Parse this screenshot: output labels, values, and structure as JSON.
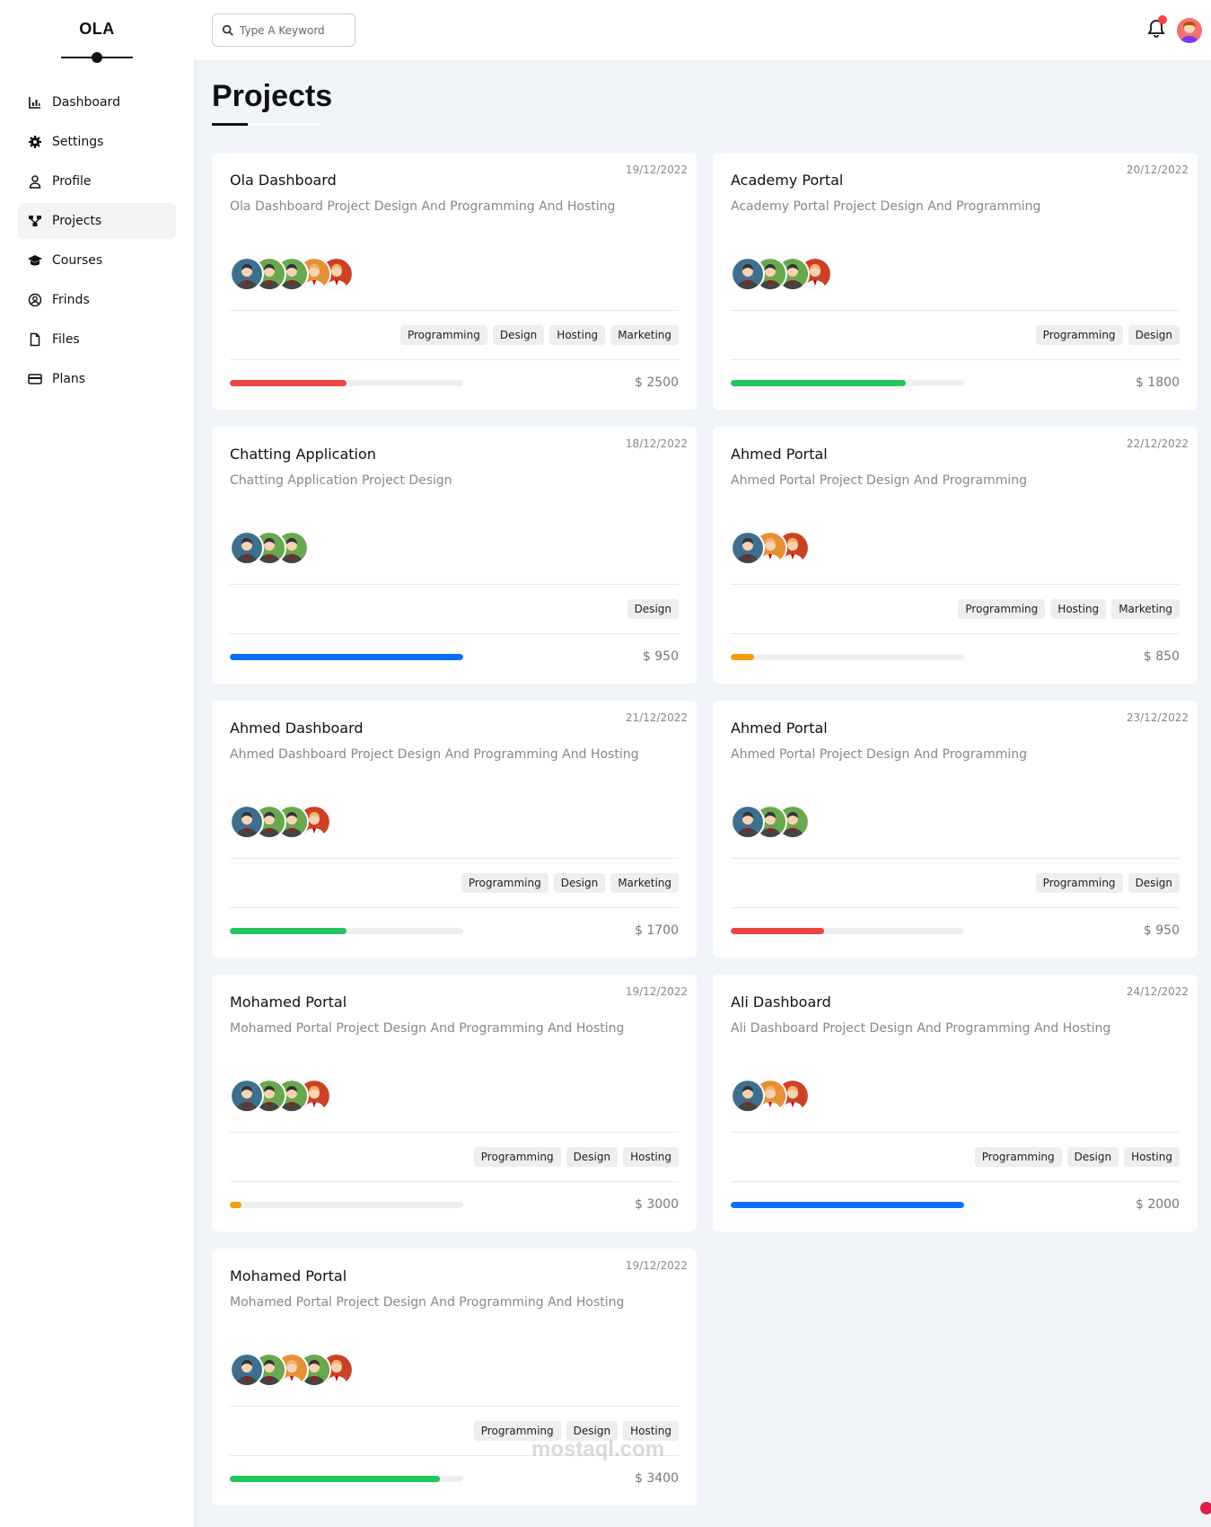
{
  "logo": "OLA",
  "sidebar": {
    "items": [
      {
        "label": "Dashboard",
        "icon": "chart-icon"
      },
      {
        "label": "Settings",
        "icon": "gear-icon"
      },
      {
        "label": "Profile",
        "icon": "user-icon"
      },
      {
        "label": "Projects",
        "icon": "diagram-icon",
        "active": true
      },
      {
        "label": "Courses",
        "icon": "graduation-cap-icon"
      },
      {
        "label": "Frinds",
        "icon": "user-circle-icon"
      },
      {
        "label": "Files",
        "icon": "file-icon"
      },
      {
        "label": "Plans",
        "icon": "credit-card-icon"
      }
    ]
  },
  "header": {
    "search_placeholder": "Type A Keyword"
  },
  "page_title": "Projects",
  "colors": {
    "red": "#ef4444",
    "green": "#22c55e",
    "blue": "#0d6efd",
    "orange": "#f59e0b"
  },
  "projects": [
    {
      "title": "Ola Dashboard",
      "date": "19/12/2022",
      "desc": "Ola Dashboard Project Design And Programming And Hosting",
      "avatars": [
        "blue",
        "green",
        "green",
        "orange",
        "red"
      ],
      "tags": [
        "Programming",
        "Design",
        "Hosting",
        "Marketing"
      ],
      "progress": 0.5,
      "color": "#ef4444",
      "price": "$ 2500"
    },
    {
      "title": "Academy Portal",
      "date": "20/12/2022",
      "desc": "Academy Portal Project Design And Programming",
      "avatars": [
        "blue",
        "green",
        "green",
        "red"
      ],
      "tags": [
        "Programming",
        "Design"
      ],
      "progress": 0.75,
      "color": "#22c55e",
      "price": "$ 1800"
    },
    {
      "title": "Chatting Application",
      "date": "18/12/2022",
      "desc": "Chatting Application Project Design",
      "avatars": [
        "blue",
        "green",
        "green"
      ],
      "tags": [
        "Design"
      ],
      "progress": 1.0,
      "color": "#0d6efd",
      "price": "$ 950"
    },
    {
      "title": "Ahmed Portal",
      "date": "22/12/2022",
      "desc": "Ahmed Portal Project Design And Programming",
      "avatars": [
        "blue",
        "orange",
        "red"
      ],
      "tags": [
        "Programming",
        "Hosting",
        "Marketing"
      ],
      "progress": 0.1,
      "color": "#f59e0b",
      "price": "$ 850"
    },
    {
      "title": "Ahmed Dashboard",
      "date": "21/12/2022",
      "desc": "Ahmed Dashboard Project Design And Programming And Hosting",
      "avatars": [
        "blue",
        "green",
        "green",
        "red"
      ],
      "tags": [
        "Programming",
        "Design",
        "Marketing"
      ],
      "progress": 0.5,
      "color": "#22c55e",
      "price": "$ 1700"
    },
    {
      "title": "Ahmed Portal",
      "date": "23/12/2022",
      "desc": "Ahmed Portal Project Design And Programming",
      "avatars": [
        "blue",
        "green",
        "green"
      ],
      "tags": [
        "Programming",
        "Design"
      ],
      "progress": 0.4,
      "color": "#ef4444",
      "price": "$ 950"
    },
    {
      "title": "Mohamed Portal",
      "date": "19/12/2022",
      "desc": "Mohamed Portal Project Design And Programming And Hosting",
      "avatars": [
        "blue",
        "green",
        "green",
        "red"
      ],
      "tags": [
        "Programming",
        "Design",
        "Hosting"
      ],
      "progress": 0.05,
      "color": "#f59e0b",
      "price": "$ 3000"
    },
    {
      "title": "Ali Dashboard",
      "date": "24/12/2022",
      "desc": "Ali Dashboard Project Design And Programming And Hosting",
      "avatars": [
        "blue",
        "orange",
        "red"
      ],
      "tags": [
        "Programming",
        "Design",
        "Hosting"
      ],
      "progress": 1.0,
      "color": "#0d6efd",
      "price": "$ 2000"
    },
    {
      "title": "Mohamed Portal",
      "date": "19/12/2022",
      "desc": "Mohamed Portal Project Design And Programming And Hosting",
      "avatars": [
        "blue",
        "green",
        "orange",
        "green",
        "red"
      ],
      "tags": [
        "Programming",
        "Design",
        "Hosting"
      ],
      "progress": 0.9,
      "color": "#22c55e",
      "price": "$ 3400"
    }
  ],
  "watermark": "mostaql.com"
}
